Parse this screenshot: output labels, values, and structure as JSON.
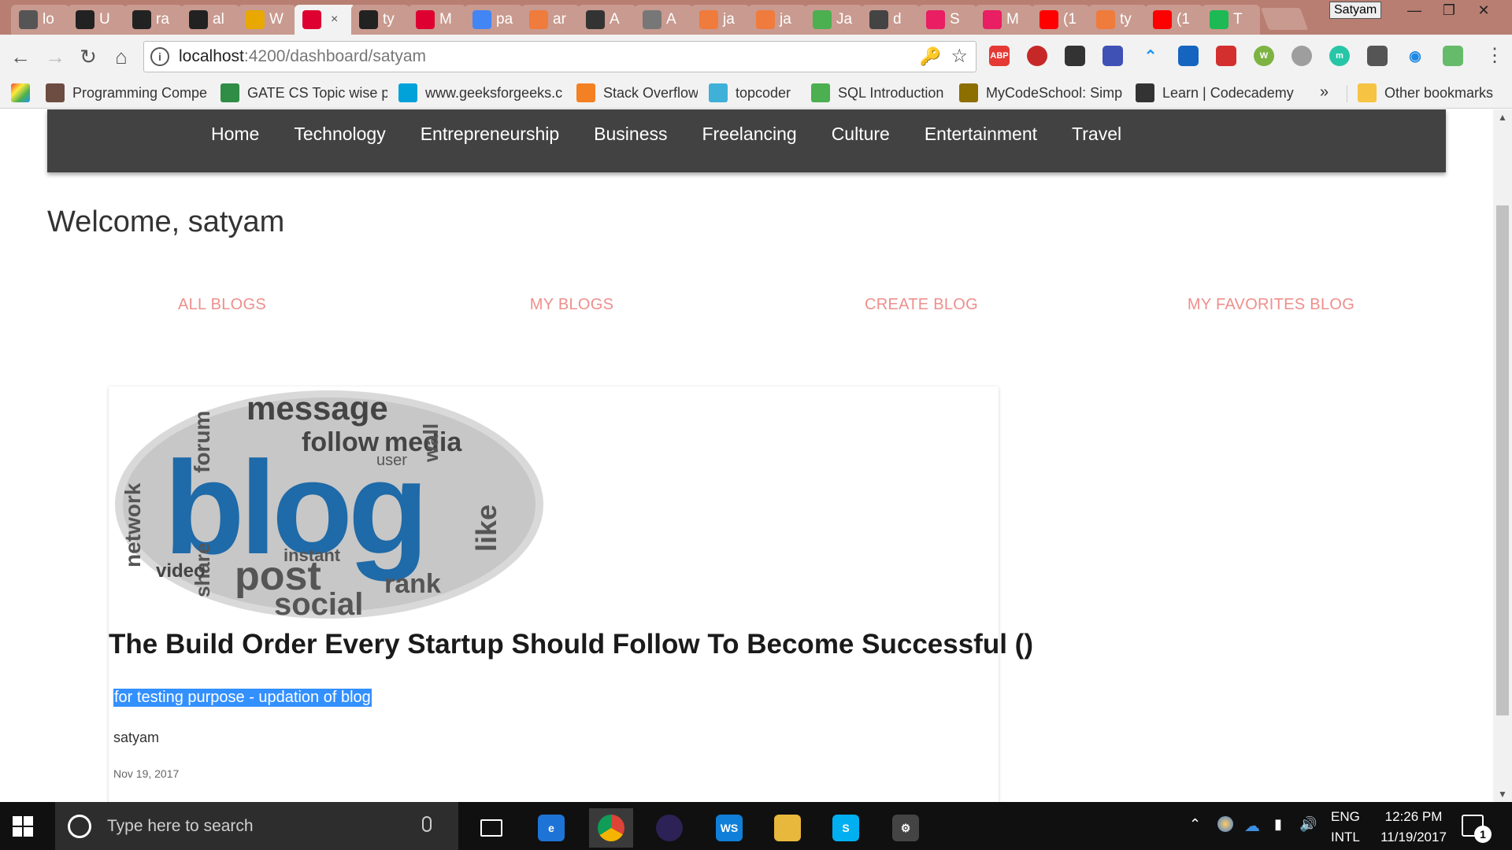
{
  "browser": {
    "tabs": [
      {
        "label": "lo",
        "icon": "smiley-icon",
        "color": "#555555"
      },
      {
        "label": "U",
        "icon": "github-icon",
        "color": "#222222"
      },
      {
        "label": "ra",
        "icon": "github-icon",
        "color": "#222222"
      },
      {
        "label": "al",
        "icon": "github-icon",
        "color": "#222222"
      },
      {
        "label": "W",
        "icon": "ih-icon",
        "color": "#e8a800"
      },
      {
        "label": "",
        "icon": "angular-icon",
        "color": "#dd0031",
        "active": true
      },
      {
        "label": "ty",
        "icon": "github-icon",
        "color": "#222222"
      },
      {
        "label": "M",
        "icon": "angular-icon",
        "color": "#dd0031"
      },
      {
        "label": "pa",
        "icon": "google-icon",
        "color": "#4285f4"
      },
      {
        "label": "ar",
        "icon": "dzone-icon",
        "color": "#ef7b3c"
      },
      {
        "label": "A",
        "icon": "medium-icon",
        "color": "#333333"
      },
      {
        "label": "A",
        "icon": "list-icon",
        "color": "#777777"
      },
      {
        "label": "ja",
        "icon": "dzone-icon",
        "color": "#ef7b3c"
      },
      {
        "label": "ja",
        "icon": "dzone-icon",
        "color": "#ef7b3c"
      },
      {
        "label": "Ja",
        "icon": "w3-icon",
        "color": "#4caf50"
      },
      {
        "label": "d",
        "icon": "elephant-icon",
        "color": "#444444"
      },
      {
        "label": "S",
        "icon": "play-icon",
        "color": "#e91e63"
      },
      {
        "label": "M",
        "icon": "play-icon",
        "color": "#e91e63"
      },
      {
        "label": "(1",
        "icon": "youtube-icon",
        "color": "#ff0000"
      },
      {
        "label": "ty",
        "icon": "dzone-icon",
        "color": "#ef7b3c"
      },
      {
        "label": "(1",
        "icon": "youtube-icon",
        "color": "#ff0000"
      },
      {
        "label": "T",
        "icon": "robot-icon",
        "color": "#1db954"
      }
    ],
    "active_tab_close": "×",
    "profile_name": "Satyam",
    "window_controls": {
      "minimize": "—",
      "restore": "❐",
      "close": "✕"
    },
    "url_host": "localhost",
    "url_path": ":4200/dashboard/satyam",
    "info_icon": "i",
    "bookmarks": [
      {
        "label": "Programming Compe",
        "icon": "cc-icon",
        "color": "#6d4c41"
      },
      {
        "label": "GATE CS Topic wise p",
        "icon": "gfg-icon",
        "color": "#2f8d46"
      },
      {
        "label": "www.geeksforgeeks.c",
        "icon": "t-icon",
        "color": "#00a2d9"
      },
      {
        "label": "Stack Overflow",
        "icon": "stackoverflow-icon",
        "color": "#f48024"
      },
      {
        "label": "topcoder",
        "icon": "topcoder-icon",
        "color": "#3fb0d8"
      },
      {
        "label": "SQL Introduction",
        "icon": "w3-icon",
        "color": "#4caf50"
      },
      {
        "label": "MyCodeSchool: Simp",
        "icon": "mycodeschool-icon",
        "color": "#8d6e00"
      },
      {
        "label": "Learn | Codecademy",
        "icon": "codecademy-icon",
        "color": "#333333"
      }
    ],
    "bookmarks_more": "»",
    "other_bookmarks": "Other bookmarks"
  },
  "site": {
    "nav": [
      "Home",
      "Technology",
      "Entrepreneurship",
      "Business",
      "Freelancing",
      "Culture",
      "Entertainment",
      "Travel"
    ],
    "welcome": "Welcome, satyam",
    "dashboard_tabs": [
      "ALL BLOGS",
      "MY BLOGS",
      "CREATE BLOG",
      "MY FAVORITES BLOG"
    ],
    "blog_card": {
      "image_words": [
        "message",
        "follow",
        "media",
        "blog",
        "post",
        "social",
        "network",
        "like",
        "share",
        "rank",
        "video",
        "forum",
        "wall",
        "user",
        "instant"
      ],
      "title": "The Build Order Every Startup Should Follow To Become Successful ()",
      "description": "for testing purpose - updation of blog",
      "author": "satyam",
      "date": "Nov 19, 2017"
    }
  },
  "taskbar": {
    "search_placeholder": "Type here to search",
    "lang_top": "ENG",
    "lang_bottom": "INTL",
    "time": "12:26 PM",
    "date": "11/19/2017",
    "notification_count": "1",
    "apps": [
      {
        "name": "task-view-icon",
        "label": ""
      },
      {
        "name": "edge-icon",
        "label": "e"
      },
      {
        "name": "chrome-icon",
        "label": ""
      },
      {
        "name": "eclipse-icon",
        "label": ""
      },
      {
        "name": "webstorm-icon",
        "label": "WS"
      },
      {
        "name": "file-explorer-icon",
        "label": ""
      },
      {
        "name": "skype-icon",
        "label": "S"
      },
      {
        "name": "settings-gear-icon",
        "label": "⚙"
      }
    ]
  }
}
